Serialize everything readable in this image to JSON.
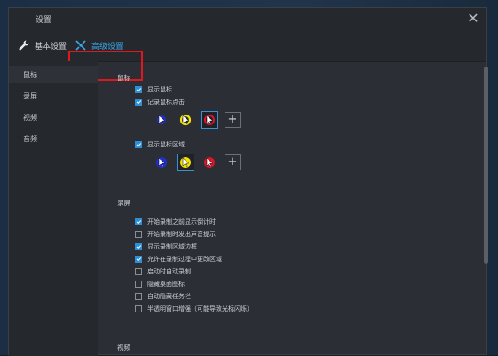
{
  "window": {
    "title": "设置",
    "close_symbol": "✕"
  },
  "tabs": [
    {
      "label": "基本设置",
      "icon": "wrench-icon"
    },
    {
      "label": "高级设置",
      "icon": "tools-icon",
      "active": true
    }
  ],
  "sidebar": {
    "items": [
      {
        "label": "鼠标",
        "selected": true
      },
      {
        "label": "录屏"
      },
      {
        "label": "视频"
      },
      {
        "label": "音频"
      }
    ]
  },
  "mouse": {
    "heading": "鼠标",
    "show_cursor": {
      "label": "显示鼠标",
      "checked": true
    },
    "record_clicks": {
      "label": "记录鼠标点击",
      "checked": true
    },
    "click_colors": [
      "#1f2fd6",
      "#f2e400",
      "#e0142a"
    ],
    "show_area": {
      "label": "显示鼠标区域",
      "checked": true
    },
    "area_colors": [
      "#1f2fd6",
      "#f2e400",
      "#e0142a"
    ],
    "add_symbol": "+"
  },
  "recording": {
    "heading": "录屏",
    "options": [
      {
        "label": "开始录制之前显示倒计时",
        "checked": true
      },
      {
        "label": "开始录制时发出声音提示",
        "checked": false
      },
      {
        "label": "显示录制区域边框",
        "checked": true
      },
      {
        "label": "允许在录制过程中更改区域",
        "checked": true
      },
      {
        "label": "启动时自动录制",
        "checked": false
      },
      {
        "label": "隐藏桌面图标",
        "checked": false
      },
      {
        "label": "自动隐藏任务栏",
        "checked": false
      },
      {
        "label": "半透明窗口增强（可能导致光标闪烁）",
        "checked": false
      }
    ]
  },
  "video": {
    "heading": "视频"
  },
  "colors": {
    "accent": "#2f8fd6",
    "highlight_box": "#e1171e",
    "active_tab": "#39a7e8"
  }
}
